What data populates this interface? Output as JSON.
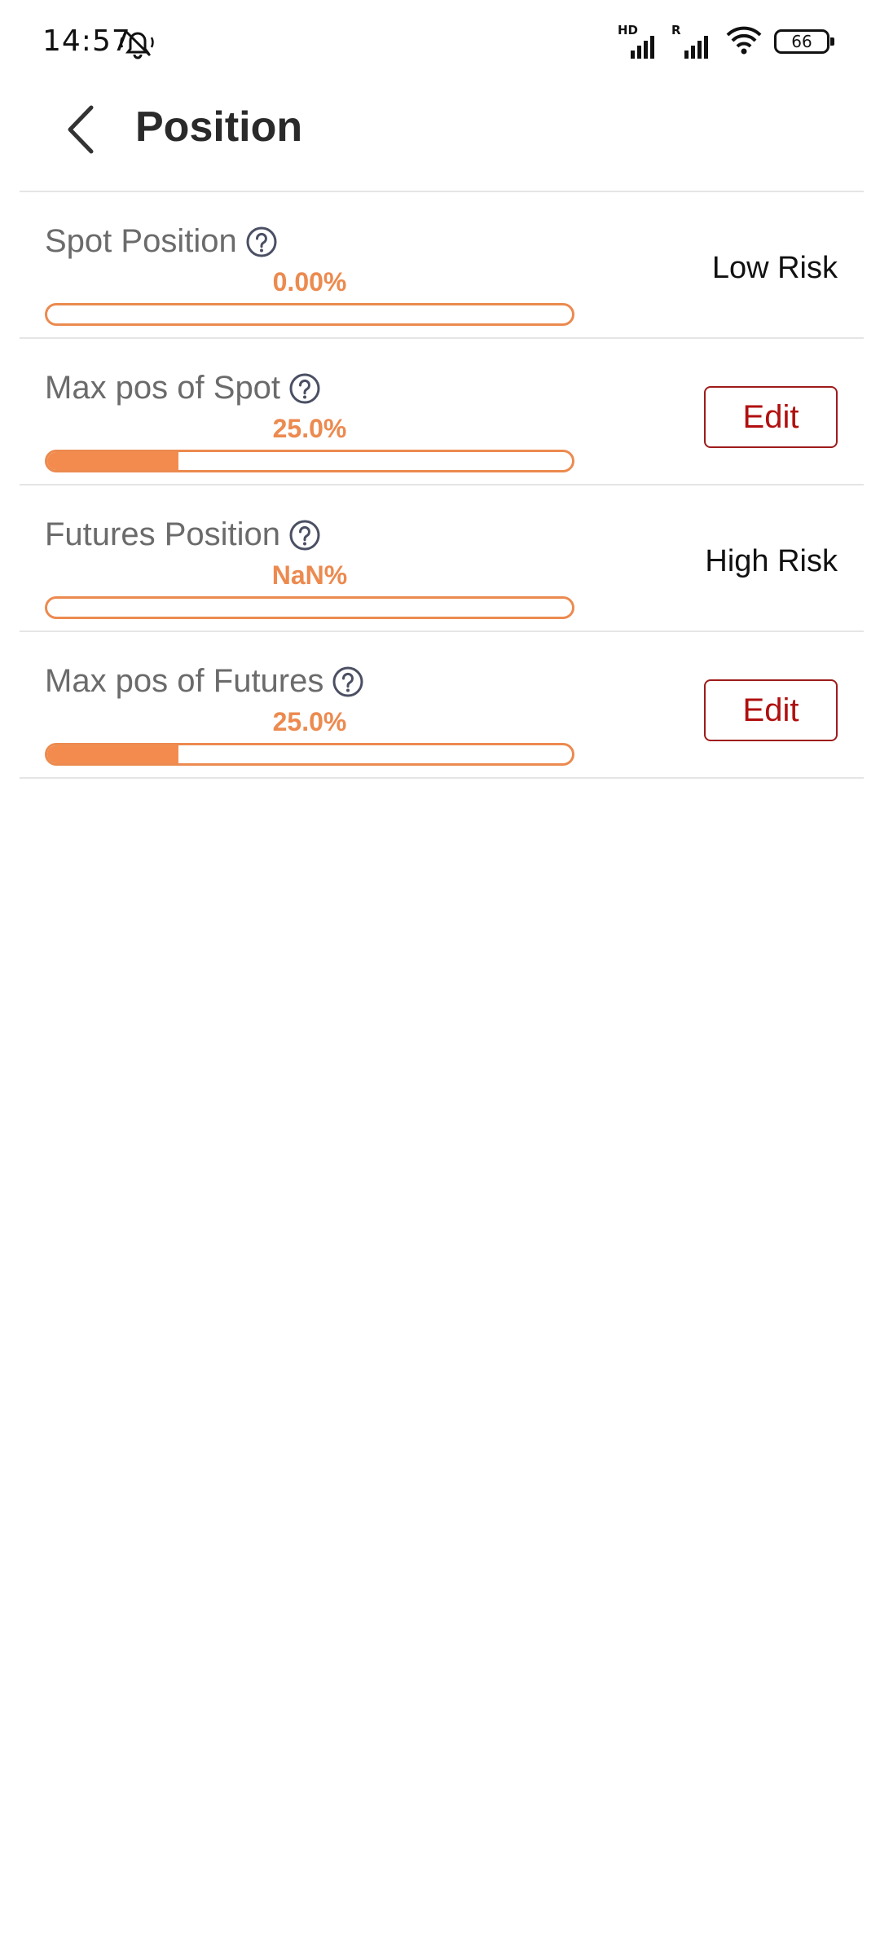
{
  "status_bar": {
    "time": "14:57",
    "signal1_tag": "HD",
    "signal2_tag": "R",
    "battery_level": "66",
    "icons": [
      "mute-bell-icon",
      "cell-signal-icon",
      "cell-signal-icon",
      "wifi-icon",
      "battery-icon"
    ]
  },
  "header": {
    "title": "Position",
    "back_icon": "chevron-left-icon"
  },
  "accent_color": "#ec8a4f",
  "edit_color": "#b00f0f",
  "rows": [
    {
      "label": "Spot Position",
      "percent_text": "0.00%",
      "progress": 0.0,
      "status": "Low Risk"
    },
    {
      "label": "Max pos of Spot",
      "percent_text": "25.0%",
      "progress": 0.25,
      "button": "Edit"
    },
    {
      "label": "Futures Position",
      "percent_text": "NaN%",
      "progress": 0.0,
      "status": "High Risk"
    },
    {
      "label": "Max pos of Futures",
      "percent_text": "25.0%",
      "progress": 0.25,
      "button": "Edit"
    }
  ]
}
